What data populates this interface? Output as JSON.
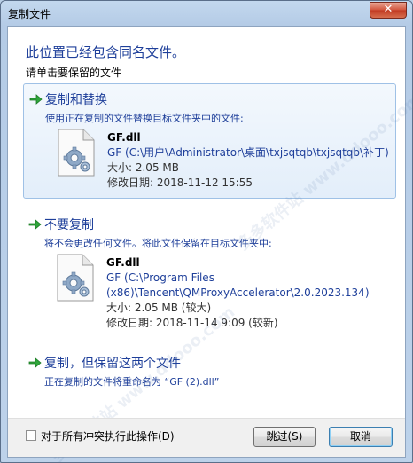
{
  "window": {
    "title": "复制文件",
    "close_label": "✕"
  },
  "heading": "此位置已经包含同名文件。",
  "subheading": "请单击要保留的文件",
  "options": [
    {
      "title": "复制和替换",
      "desc": "使用正在复制的文件替换目标文件夹中的文件:",
      "file": {
        "name": "GF.dll",
        "path": "GF (C:\\用户\\Administrator\\桌面\\txjsqtqb\\txjsqtqb\\补丁)",
        "size": "大小: 2.05 MB",
        "date": "修改日期: 2018-11-12 15:55"
      }
    },
    {
      "title": "不要复制",
      "desc": "将不会更改任何文件。将此文件保留在目标文件夹中:",
      "file": {
        "name": "GF.dll",
        "path1": "GF (C:\\Program Files",
        "path2": "(x86)\\Tencent\\QMProxyAccelerator\\2.0.2023.134)",
        "size": "大小: 2.05 MB (较大)",
        "date": "修改日期: 2018-11-14 9:09 (较新)"
      }
    },
    {
      "title": "复制，但保留这两个文件",
      "desc": "正在复制的文件将重命名为 “GF (2).dll”"
    }
  ],
  "footer": {
    "checkbox_label": "对于所有冲突执行此操作(D)",
    "skip_label": "跳过(S)",
    "cancel_label": "取消"
  },
  "watermark": "多多软件站  www.ddooo.com",
  "colors": {
    "link_blue": "#1e3f9a",
    "arrow_green": "#2fa53a"
  }
}
